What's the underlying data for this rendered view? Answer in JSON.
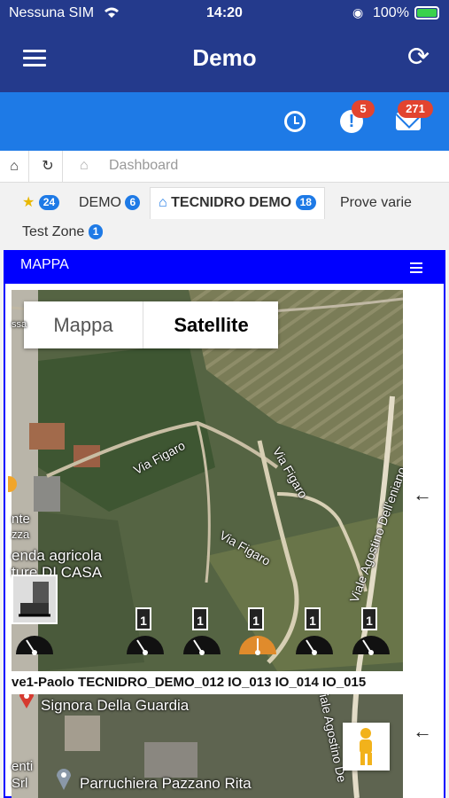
{
  "status": {
    "carrier": "Nessuna SIM",
    "time": "14:20",
    "battery": "100%"
  },
  "header": {
    "title": "Demo"
  },
  "notifications": {
    "alerts_count": "5",
    "mail_count": "271"
  },
  "breadcrumb": {
    "label": "Dashboard"
  },
  "tabs": {
    "favorites_count": "24",
    "items": [
      {
        "label": "DEMO",
        "count": "6"
      },
      {
        "label": "TECNIDRO DEMO",
        "count": "18"
      },
      {
        "label": "Prove varie"
      },
      {
        "label": "Test Zone",
        "count": "1"
      }
    ]
  },
  "panel": {
    "title": "MAPPA"
  },
  "map": {
    "toggle": {
      "map_label": "Mappa",
      "satellite_label": "Satellite"
    },
    "labels": {
      "road_1": "Via Figaro",
      "road_2": "Via Figaro",
      "road_3": "Via Figaro",
      "road_4": "Viale Agostino Dell'eniano",
      "road_5": "Viale Agostino De",
      "poi_1": "enda agricola",
      "poi_2": "ture DI CASA",
      "poi_3": "nte",
      "poi_4": "zza",
      "poi_5": "Signora Della Guardia",
      "poi_6": "Parruchiera Pazzano Rita",
      "poi_7": "enti",
      "poi_8": "Srl",
      "poi_9": "ssa"
    },
    "sensor_labels": "ve1-Paolo TECNIDRO_DEMO_012 IO_013 IO_014 IO_015",
    "sensor_counts": [
      "1",
      "1",
      "1",
      "1",
      "1"
    ]
  },
  "colors": {
    "primary": "#243a8c",
    "accent": "#1e7ae6",
    "panel_border": "#0000ff",
    "badge": "#e2442f",
    "gauge_active": "#e08b2c"
  }
}
